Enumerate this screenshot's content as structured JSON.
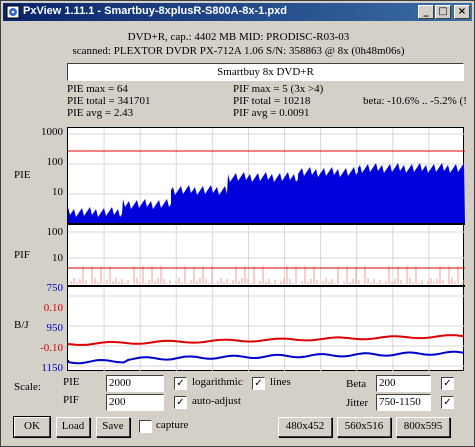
{
  "window": {
    "title": "PxView 1.11.1  -  Smartbuy-8xplusR-S800A-8x-1.pxd",
    "controls": {
      "minimize": "_",
      "maximize": "□",
      "close": "×"
    }
  },
  "header": {
    "disc_line": "DVD+R, cap.: 4402 MB MID: PRODISC-R03-03",
    "scan_line": "scanned: PLEXTOR DVDR PX-712A 1.06 S/N: 358863 @ 8x (0h48m06s)",
    "title_value": "Smartbuy 8x DVD+R"
  },
  "stats": {
    "pie_max": "PIE max = 64",
    "pie_total": "PIE total = 341701",
    "pie_avg": "PIE avg = 2.43",
    "pif_max": "PIF max = 5 (3x >4)",
    "pif_total": "PIF total = 10218",
    "pif_avg": "PIF avg = 0.0091",
    "beta": "beta: -10.6% .. -5.2% (!"
  },
  "graph": {
    "pie_label": "PIE",
    "pif_label": "PIF",
    "bj_label": "B/J",
    "pie_ticks": [
      "1000",
      "100",
      "10"
    ],
    "pif_ticks": [
      "100",
      "10"
    ],
    "bj_ticks": [
      "750",
      "0.10",
      "950",
      "-0.10",
      "1150"
    ],
    "colors": {
      "pie": "#0000dd",
      "pif": "#ff9999",
      "threshold": "#dd0000",
      "beta": "#dd0000",
      "jitter": "#0000cc"
    }
  },
  "scale": {
    "label": "Scale:",
    "pie_label": "PIE",
    "pie_value": "2000",
    "pif_label": "PIF",
    "pif_value": "200",
    "logarithmic": "logarithmic",
    "lines": "lines",
    "auto_adjust": "auto-adjust",
    "beta_label": "Beta",
    "beta_value": "200",
    "jitter_label": "Jitter",
    "jitter_value": "750-1150",
    "check": "✓"
  },
  "buttons": {
    "ok": "OK",
    "load": "Load",
    "save": "Save",
    "capture": "capture",
    "size1": "480x452",
    "size2": "560x516",
    "size3": "800x595"
  }
}
